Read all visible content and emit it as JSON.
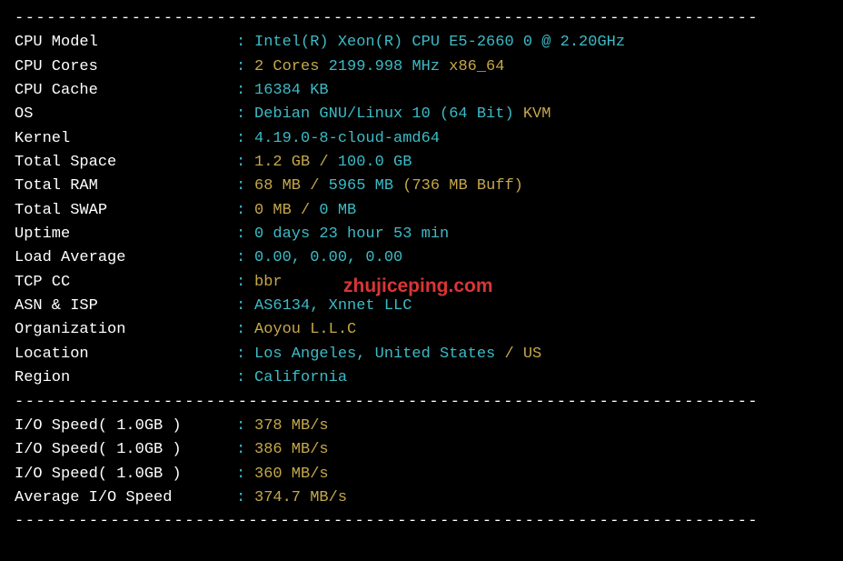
{
  "divider": "----------------------------------------------------------------------",
  "rows": [
    {
      "label": "CPU Model",
      "parts": [
        {
          "text": "Intel(R) Xeon(R) CPU E5-2660 0 @ 2.20GHz",
          "cls": "cyan"
        }
      ]
    },
    {
      "label": "CPU Cores",
      "parts": [
        {
          "text": "2 Cores",
          "cls": "yellow"
        },
        {
          "text": " 2199.998 MHz ",
          "cls": "cyan"
        },
        {
          "text": "x86_64",
          "cls": "yellow"
        }
      ]
    },
    {
      "label": "CPU Cache",
      "parts": [
        {
          "text": "16384 KB",
          "cls": "cyan"
        }
      ]
    },
    {
      "label": "OS",
      "parts": [
        {
          "text": "Debian GNU/Linux 10 (64 Bit)",
          "cls": "cyan"
        },
        {
          "text": " KVM",
          "cls": "yellow"
        }
      ]
    },
    {
      "label": "Kernel",
      "parts": [
        {
          "text": "4.19.0-8-cloud-amd64",
          "cls": "cyan"
        }
      ]
    },
    {
      "label": "Total Space",
      "parts": [
        {
          "text": "1.2 GB / ",
          "cls": "yellow"
        },
        {
          "text": "100.0 GB",
          "cls": "cyan"
        }
      ]
    },
    {
      "label": "Total RAM",
      "parts": [
        {
          "text": "68 MB / ",
          "cls": "yellow"
        },
        {
          "text": "5965 MB ",
          "cls": "cyan"
        },
        {
          "text": "(736 MB Buff)",
          "cls": "yellow"
        }
      ]
    },
    {
      "label": "Total SWAP",
      "parts": [
        {
          "text": "0 MB / ",
          "cls": "yellow"
        },
        {
          "text": "0 MB",
          "cls": "cyan"
        }
      ]
    },
    {
      "label": "Uptime",
      "parts": [
        {
          "text": "0 days 23 hour 53 min",
          "cls": "cyan"
        }
      ]
    },
    {
      "label": "Load Average",
      "parts": [
        {
          "text": "0.00, 0.00, 0.00",
          "cls": "cyan"
        }
      ]
    },
    {
      "label": "TCP CC",
      "parts": [
        {
          "text": "bbr",
          "cls": "yellow"
        }
      ]
    },
    {
      "label": "ASN & ISP",
      "parts": [
        {
          "text": "AS6134, Xnnet LLC",
          "cls": "cyan"
        }
      ]
    },
    {
      "label": "Organization",
      "parts": [
        {
          "text": "Aoyou L.L.C",
          "cls": "yellow"
        }
      ]
    },
    {
      "label": "Location",
      "parts": [
        {
          "text": "Los Angeles, United States",
          "cls": "cyan"
        },
        {
          "text": " / US",
          "cls": "yellow"
        }
      ]
    },
    {
      "label": "Region",
      "parts": [
        {
          "text": "California",
          "cls": "cyan"
        }
      ]
    }
  ],
  "io_rows": [
    {
      "label": "I/O Speed( 1.0GB )",
      "parts": [
        {
          "text": "378 MB/s",
          "cls": "yellow"
        }
      ]
    },
    {
      "label": "I/O Speed( 1.0GB )",
      "parts": [
        {
          "text": "386 MB/s",
          "cls": "yellow"
        }
      ]
    },
    {
      "label": "I/O Speed( 1.0GB )",
      "parts": [
        {
          "text": "360 MB/s",
          "cls": "yellow"
        }
      ]
    },
    {
      "label": "Average I/O Speed",
      "parts": [
        {
          "text": "374.7 MB/s",
          "cls": "yellow"
        }
      ]
    }
  ],
  "watermark": "zhujiceping.com"
}
